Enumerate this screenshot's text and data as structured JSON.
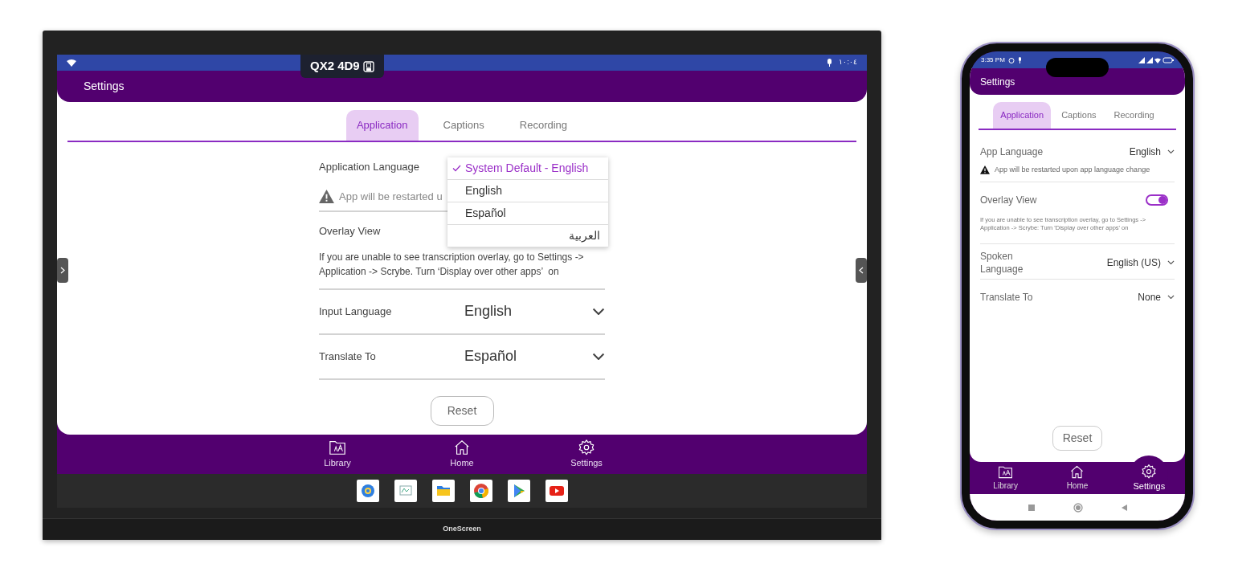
{
  "display": {
    "status_bar": {
      "clock": "١٠:٠٤"
    },
    "cast_badge": {
      "code": "QX2 4D9"
    },
    "app": {
      "title": "Settings",
      "tabs": [
        {
          "label": "Application",
          "selected": true
        },
        {
          "label": "Captions",
          "selected": false
        },
        {
          "label": "Recording",
          "selected": false
        }
      ],
      "groups": [
        [
          {
            "kind": "select",
            "label": "Application Language"
          },
          {
            "kind": "warning",
            "text": "App will be restarted u"
          }
        ],
        [
          {
            "kind": "heading",
            "label": "Overlay View"
          },
          {
            "kind": "hint",
            "text": "If you are unable to see transcription overlay, go to Settings -> Application -> Scrybe. Turn ‘Display over other apps’  on"
          }
        ],
        [
          {
            "kind": "select",
            "label": "Input Language",
            "value": "English"
          }
        ],
        [
          {
            "kind": "select",
            "label": "Translate To",
            "value": "Español"
          }
        ]
      ],
      "dropdown": [
        {
          "label": "System Default - English",
          "selected": true
        },
        {
          "label": "English",
          "selected": false
        },
        {
          "label": "Español",
          "selected": false
        },
        {
          "label": "العربية",
          "selected": false
        }
      ],
      "reset_button": "Reset",
      "bottom_nav": [
        {
          "label": "Library",
          "selected": false
        },
        {
          "label": "Home",
          "selected": false
        },
        {
          "label": "Settings",
          "selected": false
        }
      ]
    },
    "brand": "OneScreen"
  },
  "phone": {
    "status_bar": {
      "clock": "3:35 PM"
    },
    "app": {
      "title": "Settings",
      "tabs": [
        {
          "label": "Application",
          "selected": true
        },
        {
          "label": "Captions",
          "selected": false
        },
        {
          "label": "Recording",
          "selected": false
        }
      ],
      "groups": [
        [
          {
            "kind": "select",
            "label": "App Language",
            "value": "English"
          },
          {
            "kind": "warning",
            "text": "App will be restarted upon app language change"
          }
        ],
        [
          {
            "kind": "toggle",
            "label": "Overlay View",
            "on": true
          },
          {
            "kind": "hint",
            "text": "If you are unable to see transcription overlay, go to Settings -> Application -> Scrybe: Turn 'Display over other apps' on"
          }
        ],
        [
          {
            "kind": "select",
            "label": "Spoken Language",
            "value": "English (US)"
          }
        ],
        [
          {
            "kind": "select",
            "label": "Translate To",
            "value": "None"
          }
        ]
      ],
      "reset_button": "Reset",
      "bottom_nav": [
        {
          "label": "Library",
          "selected": false
        },
        {
          "label": "Home",
          "selected": false
        },
        {
          "label": "Settings",
          "selected": true
        }
      ]
    }
  }
}
